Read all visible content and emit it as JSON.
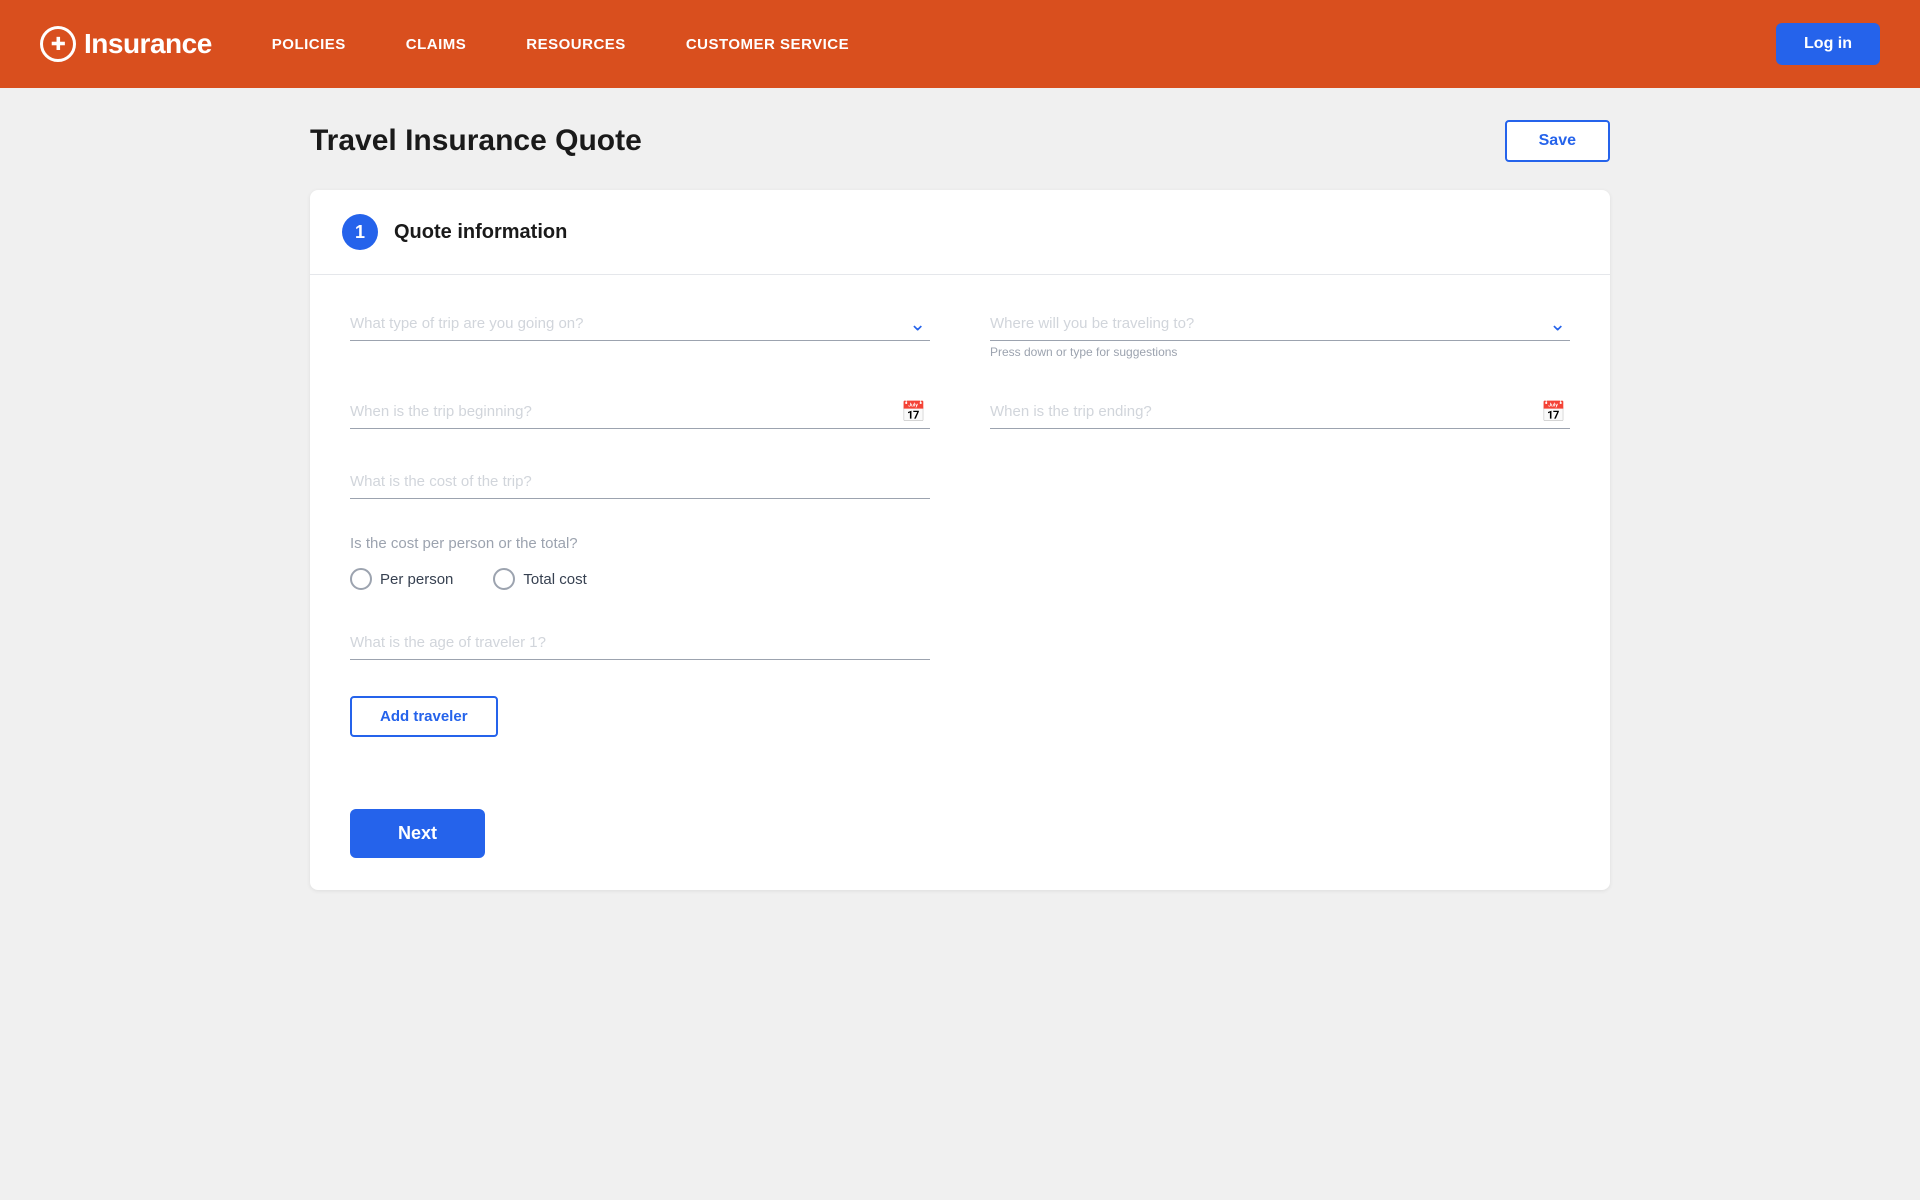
{
  "header": {
    "logo_text": "Insurance",
    "logo_icon": "✚",
    "nav_items": [
      {
        "label": "POLICIES",
        "id": "policies"
      },
      {
        "label": "CLAIMS",
        "id": "claims"
      },
      {
        "label": "RESOURCES",
        "id": "resources"
      },
      {
        "label": "CUSTOMER SERVICE",
        "id": "customer-service"
      }
    ],
    "login_label": "Log in"
  },
  "page": {
    "title": "Travel Insurance Quote",
    "save_label": "Save"
  },
  "section": {
    "step": "1",
    "title": "Quote information"
  },
  "form": {
    "trip_type_placeholder": "What type of trip are you going on?",
    "destination_placeholder": "Where will you be traveling to?",
    "destination_hint": "Press down or type for suggestions",
    "trip_start_placeholder": "When is the trip beginning?",
    "trip_end_placeholder": "When is the trip ending?",
    "trip_cost_placeholder": "What is the cost of the trip?",
    "cost_question": "Is the cost per person or the total?",
    "per_person_label": "Per person",
    "total_cost_label": "Total cost",
    "traveler_age_placeholder": "What is the age of traveler 1?",
    "add_traveler_label": "Add traveler",
    "next_label": "Next"
  }
}
